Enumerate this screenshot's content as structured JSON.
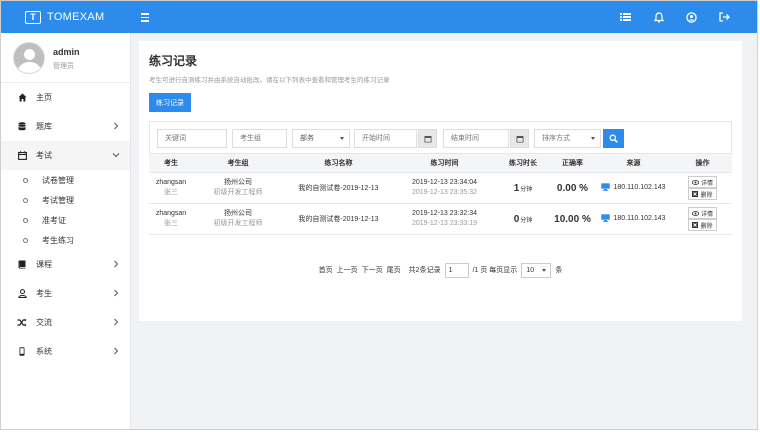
{
  "header": {
    "brand": "TOMEXAM",
    "logo_letters": "T"
  },
  "user": {
    "name": "admin",
    "role": "管理员"
  },
  "nav": {
    "home": "主页",
    "bank": "题库",
    "exam": "考试",
    "exam_sub": [
      "试卷管理",
      "考试管理",
      "准考证",
      "考生练习"
    ],
    "course": "课程",
    "examinee": "考生",
    "communication": "交流",
    "system": "系统"
  },
  "page": {
    "title": "练习记录",
    "description": "考生可进行自测练习并由系统自动批改。请在以下列表中查看和管理考生的练习记录",
    "tab": "练习记录"
  },
  "filters": {
    "keyword_placeholder": "关键词",
    "group_placeholder": "考生组",
    "dept": "部务",
    "start_placeholder": "开始时间",
    "end_placeholder": "结束时间",
    "sort": "排序方式"
  },
  "table": {
    "headers": [
      "考生",
      "考生组",
      "练习名称",
      "练习时间",
      "练习时长",
      "正确率",
      "来源",
      "操作"
    ],
    "rows": [
      {
        "user": "zhangsan",
        "user_cn": "张三",
        "group": "扬州公司",
        "group_sub": "初级开发工程师",
        "name": "我的自测试卷-2019-12-13",
        "start": "2019-12-13 23:34:04",
        "end": "2019-12-13 23:35:32",
        "duration": "1",
        "duration_unit": "分钟",
        "rate": "0.00 %",
        "ip": "180.110.102.143",
        "detail": "详情",
        "delete": "删除"
      },
      {
        "user": "zhangsan",
        "user_cn": "张三",
        "group": "扬州公司",
        "group_sub": "初级开发工程师",
        "name": "我的自测试卷-2019-12-13",
        "start": "2019-12-13 23:32:34",
        "end": "2019-12-13 23:33:19",
        "duration": "0",
        "duration_unit": "分钟",
        "rate": "10.00 %",
        "ip": "180.110.102.143",
        "detail": "详情",
        "delete": "删除"
      }
    ]
  },
  "pager": {
    "first": "首页",
    "prev": "上一页",
    "next": "下一页",
    "last": "尾页",
    "total": "共2条记录",
    "page": "1",
    "of_pages": "/1 页 每页显示",
    "size": "10",
    "unit": "条"
  },
  "colors": {
    "primary": "#2d8ceb"
  }
}
